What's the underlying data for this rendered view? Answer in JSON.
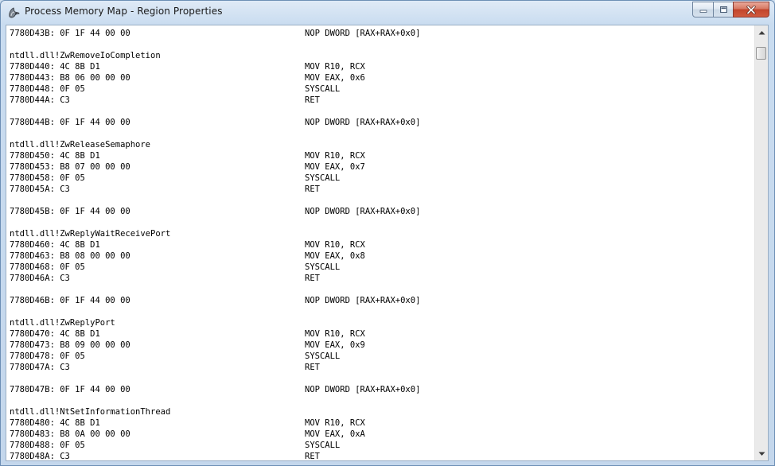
{
  "window": {
    "title": "Process Memory Map - Region Properties",
    "icon": "stylized-app-icon"
  },
  "caption_buttons": {
    "minimize_icon": "minimize-icon",
    "maximize_icon": "maximize-icon",
    "close_icon": "close-icon",
    "close_color": "#c7472e"
  },
  "disassembly": {
    "lines": [
      {
        "a": "7780D43B: 0F 1F 44 00 00",
        "i": "NOP DWORD [RAX+RAX+0x0]"
      },
      {
        "a": "",
        "i": ""
      },
      {
        "a": "ntdll.dll!ZwRemoveIoCompletion",
        "i": ""
      },
      {
        "a": "7780D440: 4C 8B D1",
        "i": "MOV R10, RCX"
      },
      {
        "a": "7780D443: B8 06 00 00 00",
        "i": "MOV EAX, 0x6"
      },
      {
        "a": "7780D448: 0F 05",
        "i": "SYSCALL"
      },
      {
        "a": "7780D44A: C3",
        "i": "RET"
      },
      {
        "a": "",
        "i": ""
      },
      {
        "a": "7780D44B: 0F 1F 44 00 00",
        "i": "NOP DWORD [RAX+RAX+0x0]"
      },
      {
        "a": "",
        "i": ""
      },
      {
        "a": "ntdll.dll!ZwReleaseSemaphore",
        "i": ""
      },
      {
        "a": "7780D450: 4C 8B D1",
        "i": "MOV R10, RCX"
      },
      {
        "a": "7780D453: B8 07 00 00 00",
        "i": "MOV EAX, 0x7"
      },
      {
        "a": "7780D458: 0F 05",
        "i": "SYSCALL"
      },
      {
        "a": "7780D45A: C3",
        "i": "RET"
      },
      {
        "a": "",
        "i": ""
      },
      {
        "a": "7780D45B: 0F 1F 44 00 00",
        "i": "NOP DWORD [RAX+RAX+0x0]"
      },
      {
        "a": "",
        "i": ""
      },
      {
        "a": "ntdll.dll!ZwReplyWaitReceivePort",
        "i": ""
      },
      {
        "a": "7780D460: 4C 8B D1",
        "i": "MOV R10, RCX"
      },
      {
        "a": "7780D463: B8 08 00 00 00",
        "i": "MOV EAX, 0x8"
      },
      {
        "a": "7780D468: 0F 05",
        "i": "SYSCALL"
      },
      {
        "a": "7780D46A: C3",
        "i": "RET"
      },
      {
        "a": "",
        "i": ""
      },
      {
        "a": "7780D46B: 0F 1F 44 00 00",
        "i": "NOP DWORD [RAX+RAX+0x0]"
      },
      {
        "a": "",
        "i": ""
      },
      {
        "a": "ntdll.dll!ZwReplyPort",
        "i": ""
      },
      {
        "a": "7780D470: 4C 8B D1",
        "i": "MOV R10, RCX"
      },
      {
        "a": "7780D473: B8 09 00 00 00",
        "i": "MOV EAX, 0x9"
      },
      {
        "a": "7780D478: 0F 05",
        "i": "SYSCALL"
      },
      {
        "a": "7780D47A: C3",
        "i": "RET"
      },
      {
        "a": "",
        "i": ""
      },
      {
        "a": "7780D47B: 0F 1F 44 00 00",
        "i": "NOP DWORD [RAX+RAX+0x0]"
      },
      {
        "a": "",
        "i": ""
      },
      {
        "a": "ntdll.dll!NtSetInformationThread",
        "i": ""
      },
      {
        "a": "7780D480: 4C 8B D1",
        "i": "MOV R10, RCX"
      },
      {
        "a": "7780D483: B8 0A 00 00 00",
        "i": "MOV EAX, 0xA"
      },
      {
        "a": "7780D488: 0F 05",
        "i": "SYSCALL"
      },
      {
        "a": "7780D48A: C3",
        "i": "RET"
      }
    ]
  },
  "scrollbar": {
    "up_icon": "scroll-up-arrow-icon",
    "down_icon": "scroll-down-arrow-icon",
    "scroll_position": 0.02
  }
}
